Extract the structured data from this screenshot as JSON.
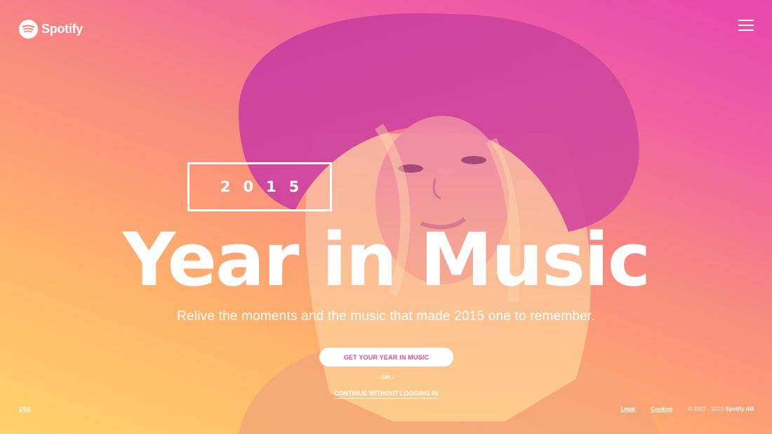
{
  "header": {
    "logo_text": "Spotify",
    "logo_icon": "spotify-logo-icon",
    "menu_icon": "hamburger-menu-icon"
  },
  "hero": {
    "year": "2015",
    "headline": "Year in Music",
    "subtitle": "Relive the moments and the music that made 2015 one to remember.",
    "cta_label": "GET YOUR YEAR IN MUSIC",
    "or_label": "- OR -",
    "continue_label": "CONTINUE WITHOUT LOGGING IN"
  },
  "footer": {
    "region": "USA",
    "legal": "Legal",
    "cookies": "Cookies",
    "copyright_prefix": "© 2007 - 2015",
    "copyright_owner": "Spotify AB"
  },
  "colors": {
    "gradient_top_right": "#e846ad",
    "gradient_bottom_left": "#ffd36a",
    "cta_text": "#e0489a"
  }
}
